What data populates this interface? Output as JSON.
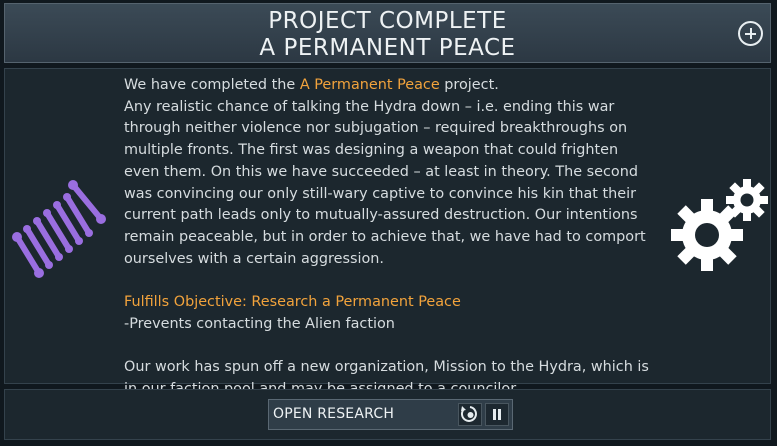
{
  "header": {
    "title_line1": "PROJECT COMPLETE",
    "title_line2": "A PERMANENT PEACE"
  },
  "body": {
    "intro_prefix": "We have completed the ",
    "project_name": "A Permanent Peace",
    "intro_suffix": " project.",
    "description": "Any realistic chance of talking the Hydra down – i.e. ending this war through neither violence nor subjugation – required breakthroughs on multiple fronts. The first was designing a weapon that could frighten even them. On this we have succeeded – at least in theory. The second was convincing our only still-wary captive to convince his kin that their current path leads only to mutually-assured destruction. Our intentions remain peaceable, but in order to achieve that, we have had to comport ourselves with a certain aggression.",
    "objective": "Fulfills Objective: Research a Permanent Peace",
    "effect": "-Prevents contacting the Alien faction",
    "spinoff": "Our work has spun off a new organization, Mission to the Hydra, which is in our faction pool and may be assigned to a councilor."
  },
  "footer": {
    "open_research_label": "OPEN RESEARCH"
  },
  "icons": {
    "left": "dna-icon",
    "right": "gears-icon",
    "header_button": "plus-circle-icon",
    "research_button": "research-cycle-icon",
    "pause_button": "pause-icon"
  },
  "colors": {
    "highlight": "#f2a33c",
    "dna": "#9a6ee0"
  }
}
